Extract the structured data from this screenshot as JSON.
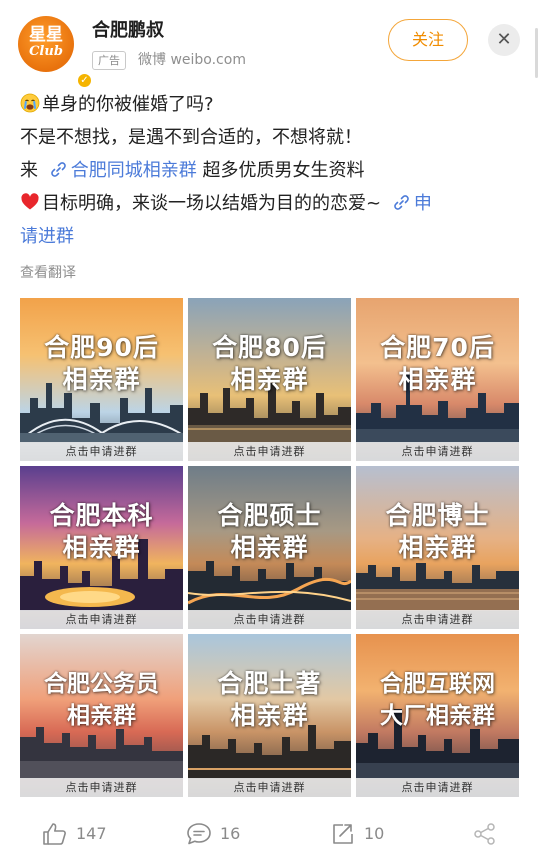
{
  "header": {
    "avatar_text": "星星",
    "avatar_sub": "Club",
    "username": "合肥鹏叔",
    "ad_badge": "广告",
    "source": "微博 weibo.com",
    "follow_label": "关注",
    "close_icon": "close-icon",
    "verified_icon": "verified-badge-icon"
  },
  "post": {
    "line1": "单身的你被催婚了吗?",
    "line2": "不是不想找，是遇不到合适的，不想将就！",
    "line3_prefix": "来",
    "line3_link": "合肥同城相亲群",
    "line3_suffix": "超多优质男女生资料",
    "line4_text": "目标明确，来谈一场以结婚为目的的恋爱~",
    "line4_link_a": "申",
    "line4_link_b": "请进群",
    "emoji_1": "crying-face-emoji",
    "emoji_2": "red-heart-emoji",
    "link_icon": "link-icon"
  },
  "translate_label": "查看翻译",
  "grid": [
    {
      "title_1": "合肥90后",
      "title_2": "相亲群",
      "cta": "点击申请进群"
    },
    {
      "title_1": "合肥80后",
      "title_2": "相亲群",
      "cta": "点击申请进群"
    },
    {
      "title_1": "合肥70后",
      "title_2": "相亲群",
      "cta": "点击申请进群"
    },
    {
      "title_1": "合肥本科",
      "title_2": "相亲群",
      "cta": "点击申请进群"
    },
    {
      "title_1": "合肥硕士",
      "title_2": "相亲群",
      "cta": "点击申请进群"
    },
    {
      "title_1": "合肥博士",
      "title_2": "相亲群",
      "cta": "点击申请进群"
    },
    {
      "title_1": "合肥公务员",
      "title_2": "相亲群",
      "cta": "点击申请进群"
    },
    {
      "title_1": "合肥土著",
      "title_2": "相亲群",
      "cta": "点击申请进群"
    },
    {
      "title_1": "合肥互联网",
      "title_2": "大厂相亲群",
      "cta": "点击申请进群"
    }
  ],
  "actions": {
    "like_count": "147",
    "comment_count": "16",
    "repost_count": "10",
    "like_icon": "thumbs-up-icon",
    "comment_icon": "comment-icon",
    "repost_icon": "repost-icon",
    "share_icon": "share-icon"
  },
  "colors": {
    "accent": "#f08c00",
    "link": "#4c7bd9",
    "muted": "#8f8f8f"
  }
}
